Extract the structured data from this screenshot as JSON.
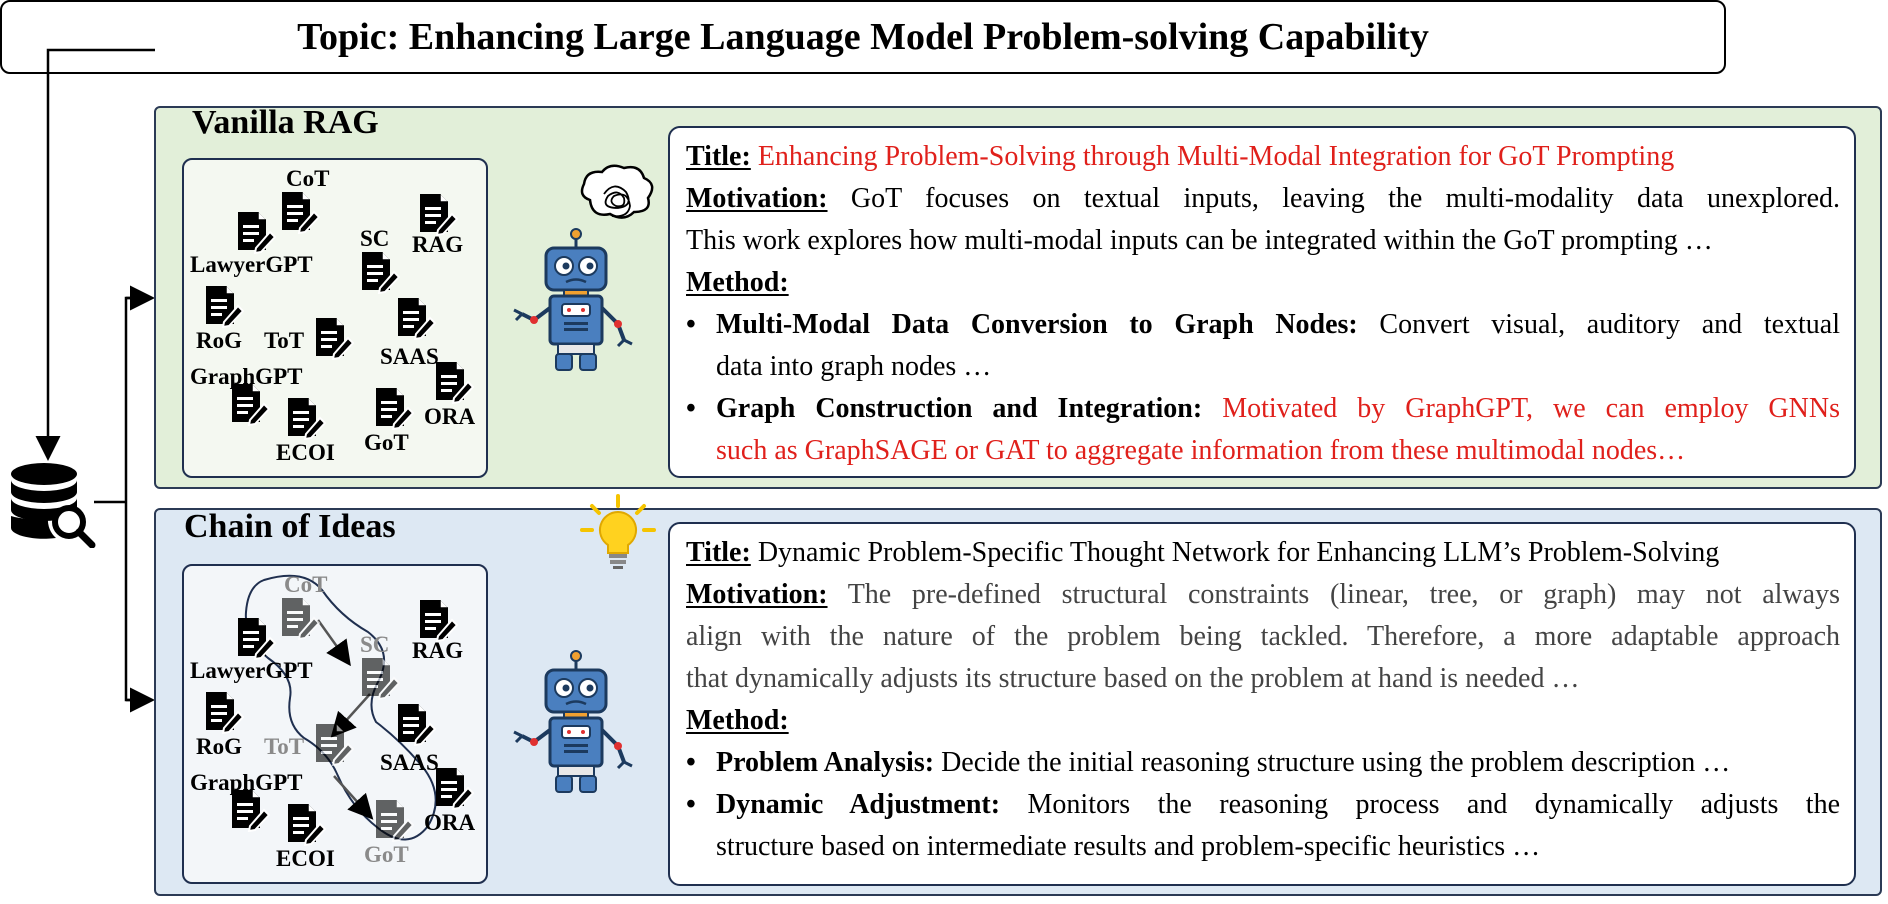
{
  "topic": "Topic: Enhancing Large Language Model Problem-solving Capability",
  "colors": {
    "red": "#e0201b",
    "rag_bg": "#e2efd9",
    "coi_bg": "#dde8f3",
    "border": "#1f2f4f"
  },
  "icons": [
    "database-search-icon",
    "document-edit-icon",
    "robot-icon",
    "thought-scribble-icon",
    "lightbulb-icon"
  ],
  "rag": {
    "panel_title": "Vanilla RAG",
    "docs": {
      "cot": "CoT",
      "lawyergpt": "LawyerGPT",
      "sc": "SC",
      "rag": "RAG",
      "rog": "RoG",
      "tot": "ToT",
      "saas": "SAAS",
      "graphgpt": "GraphGPT",
      "ora": "ORA",
      "ecoi": "ECOI",
      "got": "GoT"
    },
    "content": {
      "title_label": "Title:",
      "title_text": "Enhancing Problem-Solving through Multi-Modal Integration for GoT Prompting",
      "motivation_label": "Motivation:",
      "motivation_line1": "GoT focuses on textual inputs, leaving the multi-modality data unexplored.",
      "motivation_line2": "This work explores how multi-modal inputs can be integrated within the GoT prompting …",
      "method_label": "Method:",
      "b1_label": "Multi-Modal Data Conversion to Graph Nodes:",
      "b1_text1": "Convert visual, auditory and textual",
      "b1_text2": "data  into graph nodes …",
      "b2_label": "Graph Construction and Integration:",
      "b2_text1": "Motivated by GraphGPT, we can employ GNNs",
      "b2_text2": "such as GraphSAGE or GAT to aggregate information from these multimodal nodes…"
    }
  },
  "coi": {
    "panel_title": "Chain of Ideas",
    "docs": {
      "cot": "CoT",
      "lawyergpt": "LawyerGPT",
      "sc": "SC",
      "rag": "RAG",
      "rog": "RoG",
      "tot": "ToT",
      "saas": "SAAS",
      "graphgpt": "GraphGPT",
      "ora": "ORA",
      "ecoi": "ECOI",
      "got": "GoT"
    },
    "content": {
      "title_label": "Title:",
      "title_text": "Dynamic Problem-Specific Thought Network for Enhancing LLM’s Problem-Solving",
      "motivation_label": "Motivation:",
      "motivation_line1": "The pre-defined structural constraints (linear, tree, or graph) may not always",
      "motivation_line2": "align with the nature of the problem being tackled. Therefore, a more adaptable approach",
      "motivation_line3": "that dynamically adjusts its structure based on the problem at hand is needed …",
      "method_label": "Method:",
      "b1_label": "Problem Analysis:",
      "b1_text1": "Decide the initial reasoning structure using the problem description …",
      "b2_label": "Dynamic Adjustment:",
      "b2_text1": "Monitors the reasoning process and dynamically adjusts the",
      "b2_text2": "structure based on intermediate results and problem-specific heuristics …"
    }
  }
}
